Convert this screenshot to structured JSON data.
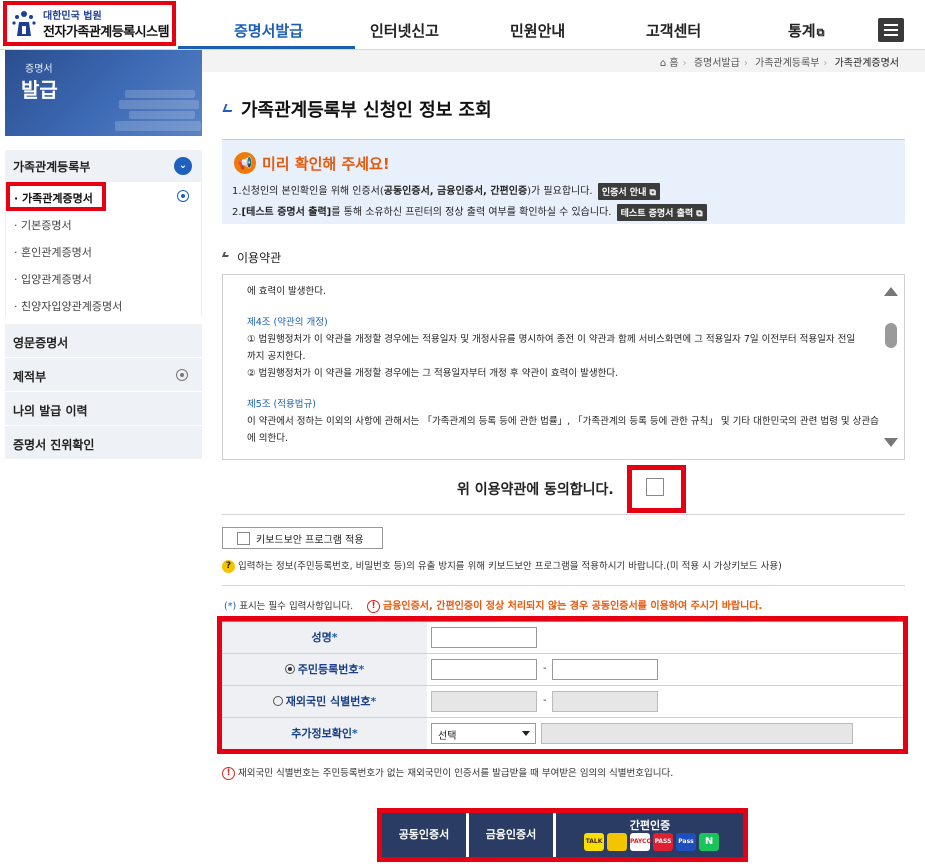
{
  "header": {
    "logo_subtitle": "대한민국 법원",
    "logo_title": "전자가족관계등록시스템",
    "nav": [
      {
        "label": "증명서발급"
      },
      {
        "label": "인터넷신고"
      },
      {
        "label": "민원안내"
      },
      {
        "label": "고객센터"
      },
      {
        "label": "통계"
      }
    ]
  },
  "banner": {
    "line1": "증명서",
    "line2": "발급"
  },
  "sidebar": {
    "section": "가족관계등록부",
    "sub_items": [
      {
        "label": "가족관계증명서"
      },
      {
        "label": "기본증명서"
      },
      {
        "label": "혼인관계증명서"
      },
      {
        "label": "입양관계증명서"
      },
      {
        "label": "친양자입양관계증명서"
      }
    ],
    "main_items": [
      {
        "label": "영문증명서"
      },
      {
        "label": "제적부"
      },
      {
        "label": "나의 발급 이력"
      },
      {
        "label": "증명서 진위확인"
      }
    ]
  },
  "breadcrumb": {
    "home": "홈",
    "level1": "증명서발급",
    "level2": "가족관계등록부",
    "current": "가족관계증명서"
  },
  "page_title": "가족관계등록부 신청인 정보 조회",
  "notice": {
    "title": "미리 확인해 주세요!",
    "line1_pre": "1.신청인의 본인확인을 위해 인증서(",
    "line1_bold": "공동인증서, 금융인증서, 간편인증",
    "line1_post": ")가 필요합니다.",
    "line1_btn": "인증서 안내",
    "line2_pre": "2.",
    "line2_bold": "[테스트 증명서 출력]",
    "line2_post": "를 통해 소유하신 프린터의 정상 출력 여부를 확인하실 수 있습니다.",
    "line2_btn": "테스트 증명서 출력"
  },
  "terms": {
    "section_title": "이용약관",
    "line0": "에 효력이 발생한다.",
    "art4_title": "제4조 (약관의 개정)",
    "art4_l1": "① 법원행정처가 이 약관을 개정할 경우에는 적용일자 및 개정사유를 명시하여 종전 이 약관과 함께 서비스화면에 그 적용일자 7일 이전부터 적용일자 전일",
    "art4_l2": "까지 공지한다.",
    "art4_l3": "② 법원행정처가 이 약관을 개정할 경우에는 그 적용일자부터 개정 후 약관이 효력이 발생한다.",
    "art5_title": "제5조 (적용법규)",
    "art5_l1": "이 약관에서 정하는 이외의 사항에 관해서는 「가족관계의 등록 등에 관한 법률」, 「가족관계의 등록 등에 관한 규칙」 및 기타 대한민국의 관련 법령 및 상관습",
    "art5_l2": "에 의한다."
  },
  "agree_label": "위 이용약관에 동의합니다.",
  "keyboard_label": "키보드보안 프로그램 적용",
  "keyboard_info": "입력하는 정보(주민등록번호, 비밀번호 등)의 유출 방지를 위해 키보드보안 프로그램을 적용하시기 바랍니다.(미 적용 시 가상키보드 사용)",
  "required_note_mark": "(*)",
  "required_note_text": "표시는 필수 입력사항입니다.",
  "warn_note": "금융인증서, 간편인증이 정상 처리되지 않는 경우 공동인증서를 이용하여 주시기 바랍니다.",
  "form": {
    "name_label": "성명",
    "rrn_label": "주민등록번호",
    "foreign_label": "재외국민 식별번호",
    "extra_label": "추가정보확인",
    "star": "*",
    "dash": "-",
    "select_value": "선택"
  },
  "footnote": "재외국민 식별번호는 주민등록번호가 없는 재외국민이 인증서를 발급받을 때 부여받은 임의의 식별번호입니다.",
  "cert": {
    "joint": "공동인증서",
    "financial": "금융인증서",
    "easy": "간편인증",
    "easy_icons": [
      "TALK",
      "",
      "PAYCO",
      "PASS",
      "Pass",
      "N"
    ]
  },
  "colors": {
    "accent": "#1a5fb4",
    "highlight": "#e60012",
    "cert_bar": "#2a3c64",
    "notice_title": "#e8590c"
  }
}
